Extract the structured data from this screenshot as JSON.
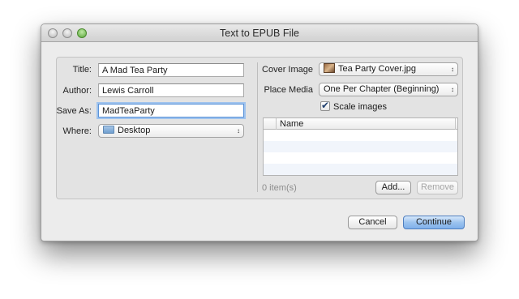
{
  "window": {
    "title": "Text to EPUB File"
  },
  "left": {
    "title_label": "Title:",
    "title_value": "A Mad Tea Party",
    "author_label": "Author:",
    "author_value": "Lewis Carroll",
    "saveas_label": "Save As:",
    "saveas_value": "MadTeaParty",
    "where_label": "Where:",
    "where_value": "Desktop"
  },
  "right": {
    "cover_label": "Cover Image",
    "cover_value": "Tea Party Cover.jpg",
    "place_label": "Place Media",
    "place_value": "One Per Chapter (Beginning)",
    "scale_label": "Scale images",
    "scale_checked": true,
    "table_header": "Name",
    "item_count": "0 item(s)",
    "add_label": "Add...",
    "remove_label": "Remove"
  },
  "buttons": {
    "cancel": "Cancel",
    "continue": "Continue"
  },
  "icons": {
    "close": "close-icon",
    "minimize": "minimize-icon",
    "zoom": "zoom-icon",
    "folder": "folder-icon",
    "image": "image-icon",
    "popup_arrows": "updown-arrows-icon",
    "checkbox": "checkmark-icon"
  }
}
